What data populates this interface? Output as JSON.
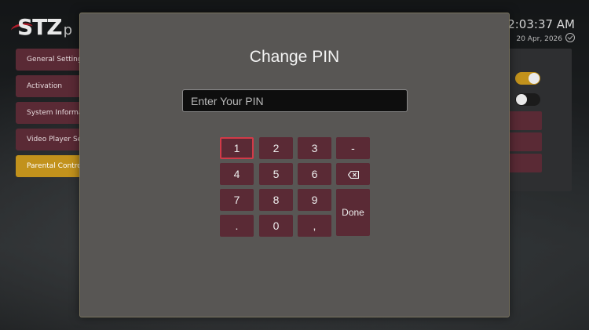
{
  "background_app": {
    "logo_text": "STZ",
    "logo_sub": "p",
    "clock": {
      "time": "02:03:37 AM",
      "date": "20 Apr, 2026"
    },
    "menu": [
      {
        "label": "General Settings"
      },
      {
        "label": "Activation"
      },
      {
        "label": "System Information"
      },
      {
        "label": "Video Player Settings"
      },
      {
        "label": "Parental Control",
        "active": true
      }
    ]
  },
  "modal": {
    "title": "Change PIN",
    "pin_placeholder": "Enter Your PIN",
    "keys": {
      "k1": "1",
      "k2": "2",
      "k3": "3",
      "dash": "-",
      "k4": "4",
      "k5": "5",
      "k6": "6",
      "backspace_icon": "backspace-icon",
      "k7": "7",
      "k8": "8",
      "k9": "9",
      "done": "Done",
      "dot": ".",
      "k0": "0",
      "comma": ","
    },
    "focused_key": "1"
  },
  "colors": {
    "key_bg": "#5a2a35",
    "focus_border": "#d23a48",
    "active_menu": "#c2921c",
    "modal_bg": "#585654"
  }
}
